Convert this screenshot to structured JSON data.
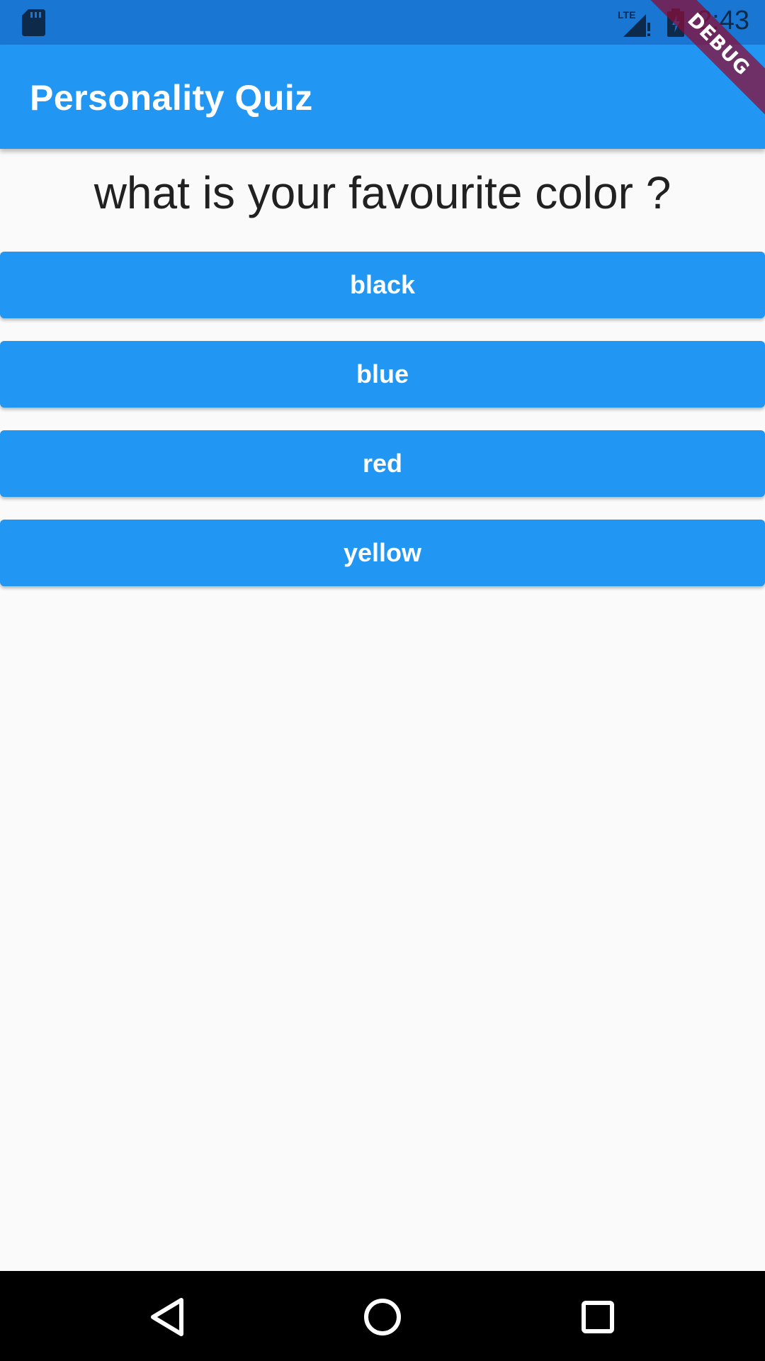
{
  "status_bar": {
    "time": "2:43",
    "icons": [
      "sd-card-icon",
      "lte-signal-icon",
      "battery-charging-icon"
    ]
  },
  "debug_banner": "DEBUG",
  "app_bar": {
    "title": "Personality Quiz"
  },
  "quiz": {
    "question": "what is your favourite color ?",
    "answers": [
      "black",
      "blue",
      "red",
      "yellow"
    ]
  },
  "nav_bar": {
    "icons": [
      "back-icon",
      "home-icon",
      "recents-icon"
    ]
  },
  "colors": {
    "primary": "#2196f3",
    "status_bar": "#1976d2",
    "background": "#fafafa",
    "debug_banner": "#880e38"
  }
}
